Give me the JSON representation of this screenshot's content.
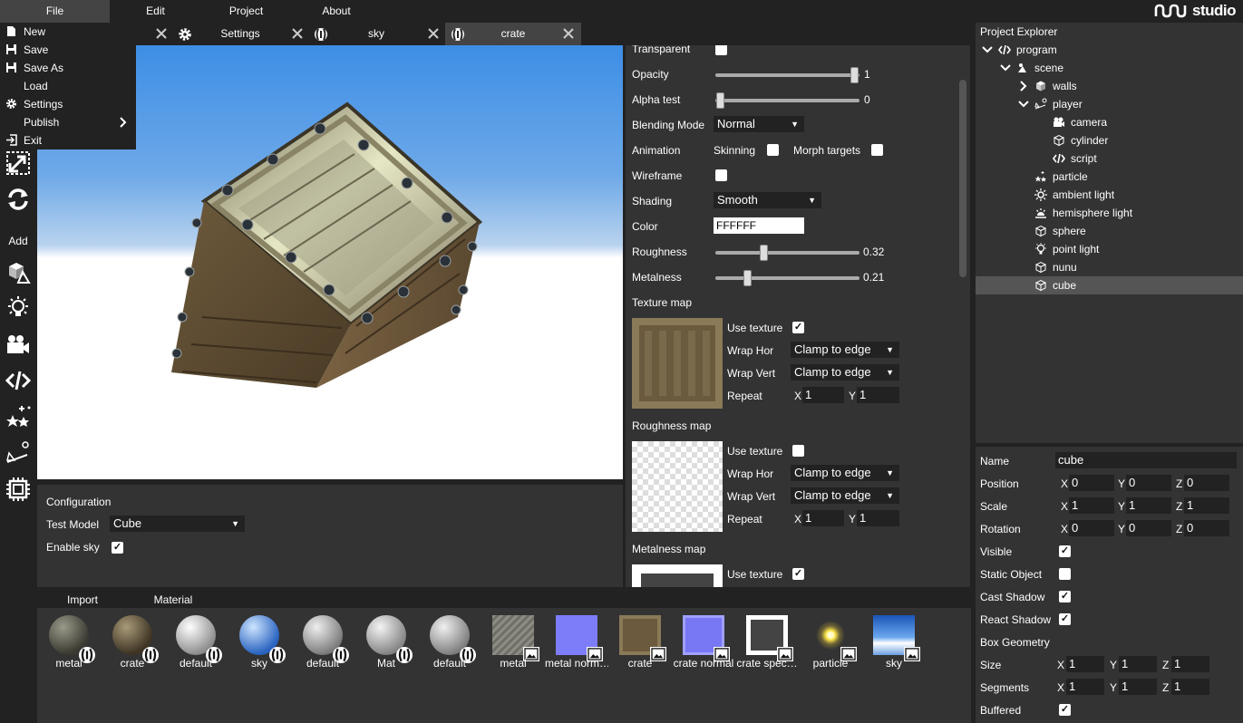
{
  "menubar": {
    "file": "File",
    "edit": "Edit",
    "project": "Project",
    "about": "About",
    "logo_text": "studio"
  },
  "file_menu": {
    "new": "New",
    "save": "Save",
    "save_as": "Save As",
    "load": "Load",
    "settings": "Settings",
    "publish": "Publish",
    "exit": "Exit"
  },
  "tabs": [
    {
      "label": "Settings",
      "icon": "gear-icon"
    },
    {
      "label": "sky",
      "icon": "material-icon"
    },
    {
      "label": "crate",
      "icon": "material-icon"
    }
  ],
  "toolbar": {
    "add_label": "Add",
    "tools": [
      "resize-icon",
      "rotate-icon",
      "cube-icon",
      "lightbulb-icon",
      "camera-icon",
      "code-icon",
      "particles-icon",
      "physics-icon",
      "chip-icon"
    ]
  },
  "config": {
    "title": "Configuration",
    "test_model_label": "Test Model",
    "test_model_value": "Cube",
    "enable_sky_label": "Enable sky",
    "enable_sky": true
  },
  "inspector": {
    "transparent_label": "Transparent",
    "opacity_label": "Opacity",
    "opacity_value": "1",
    "alpha_test_label": "Alpha test",
    "alpha_test_value": "0",
    "blending_mode_label": "Blending Mode",
    "blending_mode_value": "Normal",
    "animation_label": "Animation",
    "skinning_label": "Skinning",
    "morph_targets_label": "Morph targets",
    "wireframe_label": "Wireframe",
    "shading_label": "Shading",
    "shading_value": "Smooth",
    "color_label": "Color",
    "color_value": "FFFFFF",
    "roughness_label": "Roughness",
    "roughness_value": "0.32",
    "metalness_label": "Metalness",
    "metalness_value": "0.21",
    "texture_map_label": "Texture map",
    "roughness_map_label": "Roughness map",
    "metalness_map_label": "Metalness map",
    "use_texture_label": "Use texture",
    "wrap_hor_label": "Wrap Hor",
    "wrap_vert_label": "Wrap Vert",
    "wrap_value": "Clamp to edge",
    "repeat_label": "Repeat",
    "repeat_x": "1",
    "repeat_y": "1",
    "x_axis": "X",
    "y_axis": "Y"
  },
  "assets": {
    "import_label": "Import",
    "material_label": "Material",
    "items": [
      {
        "label": "metal",
        "kind": "material"
      },
      {
        "label": "crate",
        "kind": "material"
      },
      {
        "label": "default",
        "kind": "material"
      },
      {
        "label": "sky",
        "kind": "material"
      },
      {
        "label": "default",
        "kind": "material"
      },
      {
        "label": "Mat",
        "kind": "material"
      },
      {
        "label": "default",
        "kind": "material"
      },
      {
        "label": "metal",
        "kind": "texture"
      },
      {
        "label": "metal norm…",
        "kind": "texture"
      },
      {
        "label": "crate",
        "kind": "texture"
      },
      {
        "label": "crate normal",
        "kind": "texture"
      },
      {
        "label": "crate spec…",
        "kind": "texture"
      },
      {
        "label": "particle",
        "kind": "texture"
      },
      {
        "label": "sky",
        "kind": "texture"
      }
    ]
  },
  "explorer": {
    "title": "Project Explorer",
    "items": [
      {
        "label": "program",
        "icon": "code-icon"
      },
      {
        "label": "scene",
        "icon": "scene-icon"
      },
      {
        "label": "walls",
        "icon": "cube-icon"
      },
      {
        "label": "player",
        "icon": "physics-icon"
      },
      {
        "label": "camera",
        "icon": "camera-icon"
      },
      {
        "label": "cylinder",
        "icon": "cube-icon"
      },
      {
        "label": "script",
        "icon": "code-icon"
      },
      {
        "label": "particle",
        "icon": "particles-icon"
      },
      {
        "label": "ambient light",
        "icon": "sun-icon"
      },
      {
        "label": "hemisphere light",
        "icon": "hemisphere-icon"
      },
      {
        "label": "sphere",
        "icon": "cube-icon"
      },
      {
        "label": "point light",
        "icon": "lightbulb-icon"
      },
      {
        "label": "nunu",
        "icon": "cube-icon"
      },
      {
        "label": "cube",
        "icon": "cube-icon"
      }
    ]
  },
  "properties": {
    "name_label": "Name",
    "name_value": "cube",
    "position_label": "Position",
    "position": [
      "0",
      "0",
      "0"
    ],
    "scale_label": "Scale",
    "scale": [
      "1",
      "1",
      "1"
    ],
    "rotation_label": "Rotation",
    "rotation": [
      "0",
      "0",
      "0"
    ],
    "visible_label": "Visible",
    "visible": true,
    "static_object_label": "Static Object",
    "static_object": false,
    "cast_shadow_label": "Cast Shadow",
    "cast_shadow": true,
    "react_shadow_label": "React Shadow",
    "react_shadow": true,
    "box_geometry_label": "Box Geometry",
    "size_label": "Size",
    "size": [
      "1",
      "1",
      "1"
    ],
    "segments_label": "Segments",
    "segments": [
      "1",
      "1",
      "1"
    ],
    "buffered_label": "Buffered",
    "buffered": true,
    "x": "X",
    "y": "Y",
    "z": "Z"
  }
}
